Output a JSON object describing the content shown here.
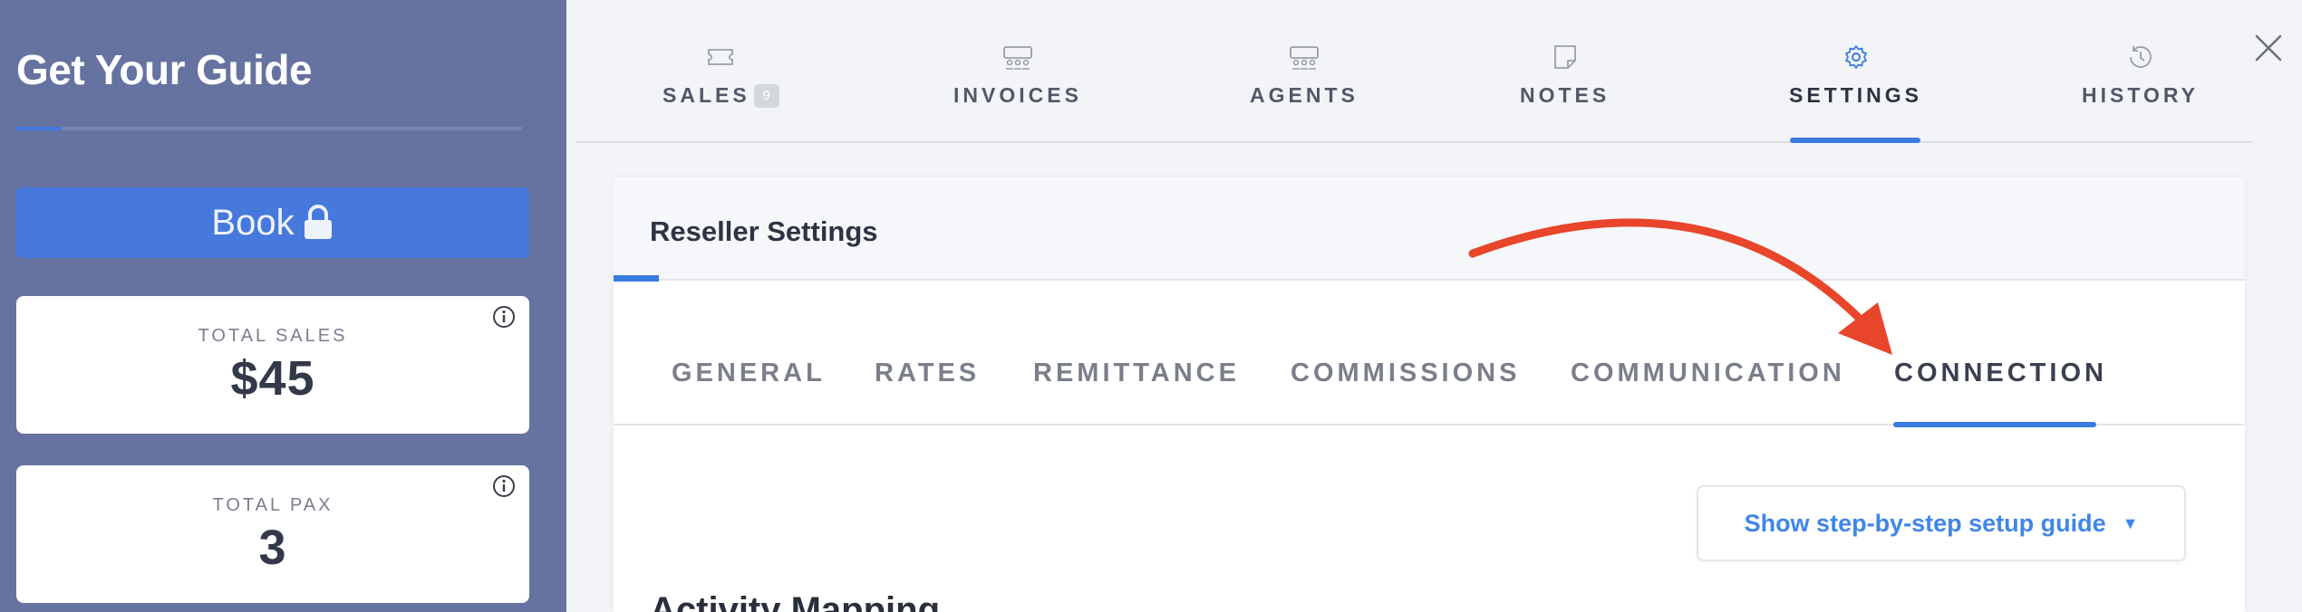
{
  "sidebar": {
    "brand_title": "Get Your Guide",
    "progress_fraction": 0.09,
    "book_label": "Book",
    "stats": [
      {
        "label": "TOTAL SALES",
        "value": "$45"
      },
      {
        "label": "TOTAL PAX",
        "value": "3"
      }
    ]
  },
  "top_tabs": [
    {
      "label": "SALES",
      "badge": "9",
      "icon": "ticket-icon"
    },
    {
      "label": "INVOICES",
      "icon": "group-icon"
    },
    {
      "label": "AGENTS",
      "icon": "group-icon"
    },
    {
      "label": "NOTES",
      "icon": "note-icon"
    },
    {
      "label": "SETTINGS",
      "icon": "gear-icon",
      "active": true
    },
    {
      "label": "HISTORY",
      "icon": "history-icon"
    }
  ],
  "panel": {
    "title": "Reseller Settings",
    "sub_tabs": [
      "GENERAL",
      "RATES",
      "REMITTANCE",
      "COMMISSIONS",
      "COMMUNICATION",
      "CONNECTION"
    ],
    "active_sub_tab": "CONNECTION",
    "guide_button": "Show step-by-step setup guide",
    "section_title": "Activity Mapping"
  },
  "colors": {
    "sidebar_bg": "#6673a1",
    "accent": "#3a7be2",
    "book_button": "#4679db",
    "annotation_arrow": "#e8452a"
  }
}
